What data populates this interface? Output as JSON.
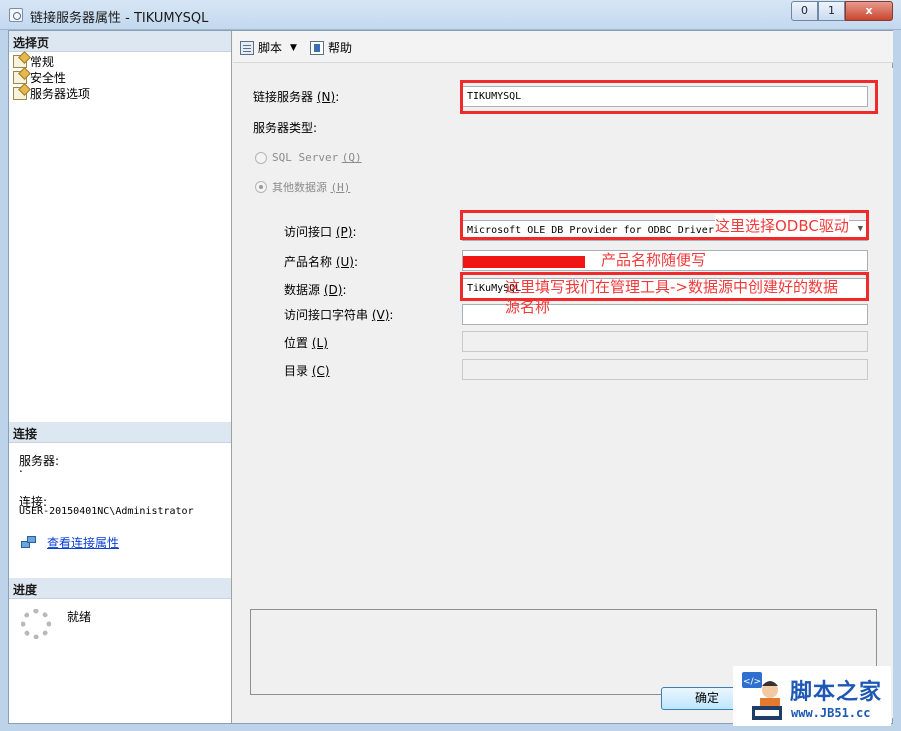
{
  "window": {
    "title": "链接服务器属性 - TIKUMYSQL",
    "min_symbol": "0",
    "max_symbol": "1",
    "close_symbol": "x"
  },
  "left_panel": {
    "select_page_heading": "选择页",
    "pages": [
      {
        "label": "常规",
        "icon": "page-icon"
      },
      {
        "label": "安全性",
        "icon": "page-icon"
      },
      {
        "label": "服务器选项",
        "icon": "page-icon"
      }
    ],
    "connection": {
      "heading": "连接",
      "server_label": "服务器:",
      "server_value": ".",
      "connection_label": "连接:",
      "connection_value": "USER-20150401NC\\Administrator",
      "view_link": "查看连接属性"
    },
    "progress": {
      "heading": "进度",
      "status": "就绪"
    }
  },
  "toolbar": {
    "script_label": "脚本",
    "help_label": "帮助"
  },
  "form": {
    "linked_server_label": "链接服务器",
    "linked_server_mn": "(N)",
    "linked_server_value": "TIKUMYSQL",
    "server_type_label": "服务器类型:",
    "sql_server_label": "SQL Server",
    "sql_server_mn": "(Q)",
    "other_source_label": "其他数据源",
    "other_source_mn": "(H)",
    "provider_label": "访问接口",
    "provider_mn": "(P)",
    "provider_value": "Microsoft OLE DB Provider for ODBC Drivers",
    "product_label": "产品名称",
    "product_mn": "(U)",
    "datasource_label": "数据源",
    "datasource_mn": "(D)",
    "datasource_value": "TiKuMySQL",
    "provider_string_label": "访问接口字符串",
    "provider_string_mn": "(V)",
    "location_label": "位置",
    "location_mn": "(L)",
    "catalog_label": "目录",
    "catalog_mn": "(C)",
    "ok_label": "确定"
  },
  "annotations": {
    "provider_note": "这里选择ODBC驱动",
    "product_note": "产品名称随便写",
    "datasource_note_line1": "这里填写我们在管理工具->数据源中创建好的数据",
    "datasource_note_line2": "源名称",
    "color": "#ee2a2a"
  },
  "watermark": {
    "title": "脚本之家",
    "url": "www.JB51.cc"
  }
}
